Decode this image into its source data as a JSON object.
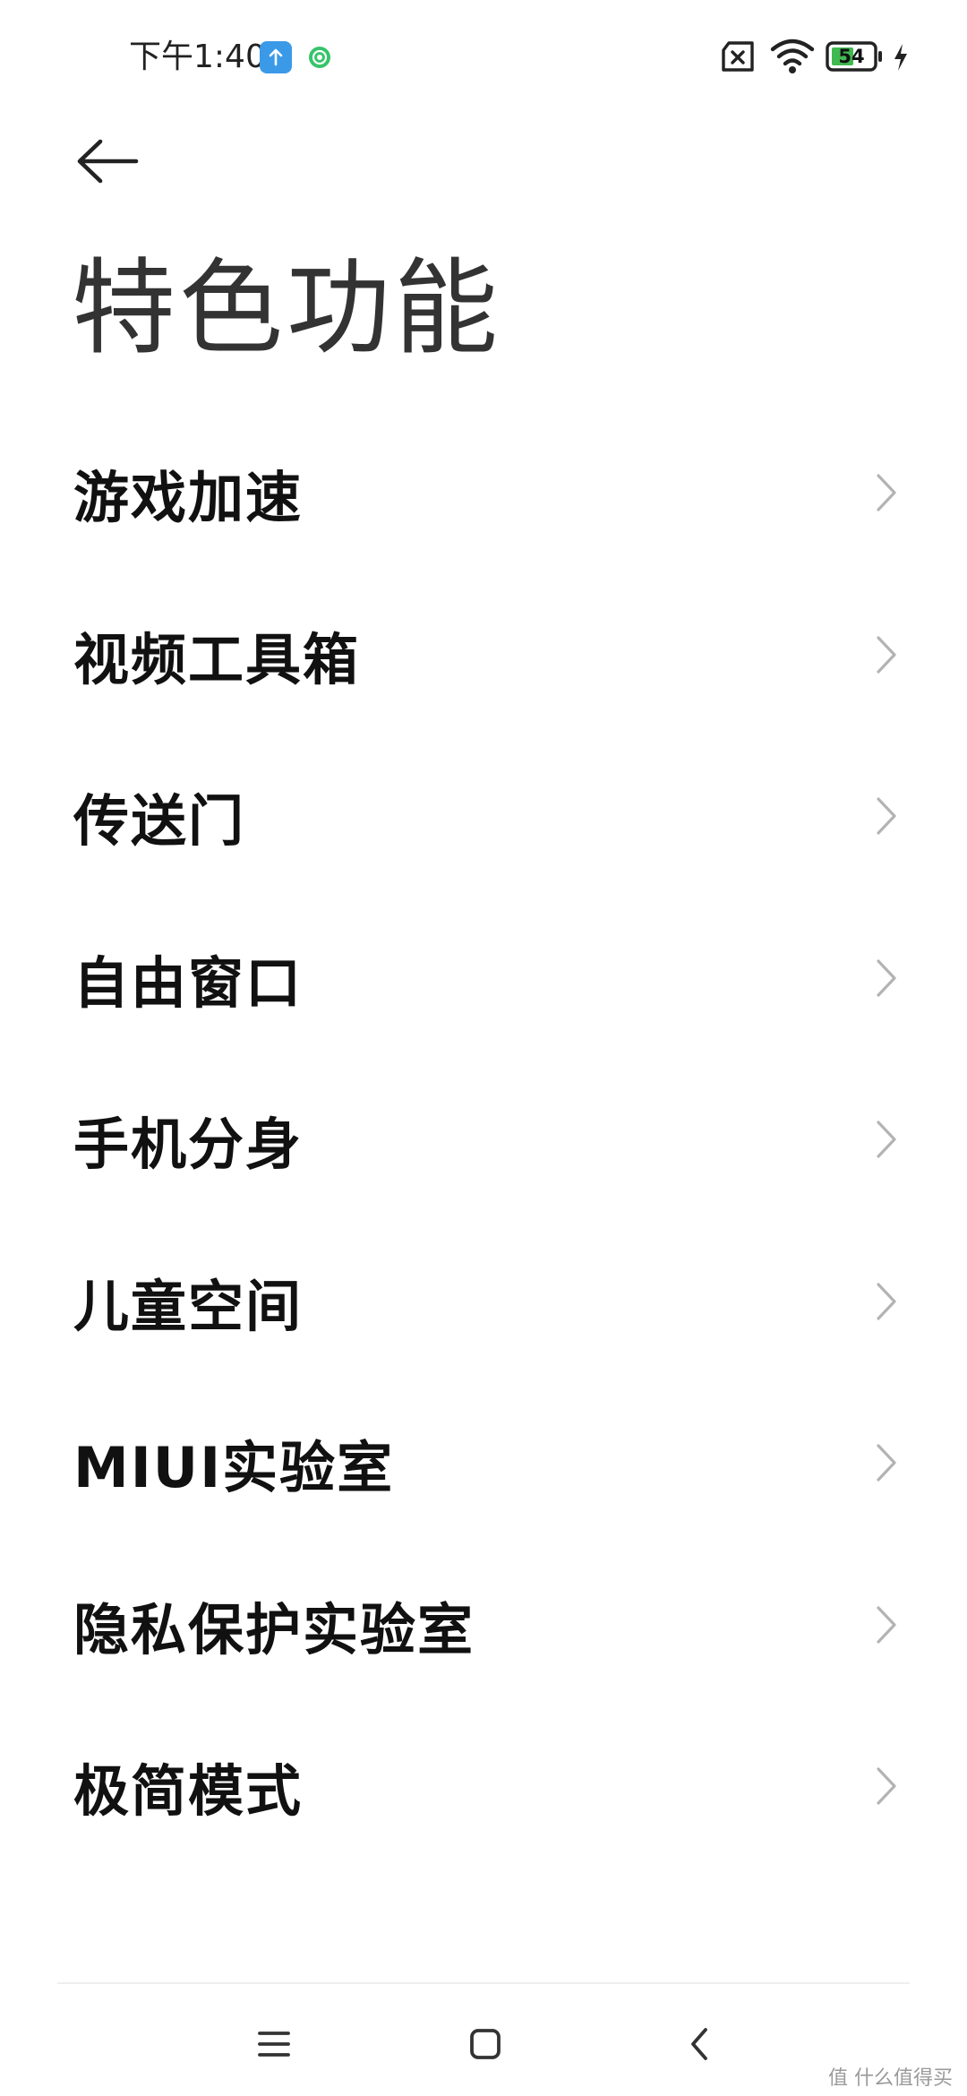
{
  "status_bar": {
    "time": "下午1:40",
    "battery_level": "54",
    "icons": [
      "upload-notification-icon",
      "green-app-notification-icon",
      "sim-error-icon",
      "wifi-icon",
      "battery-icon",
      "charging-bolt-icon"
    ],
    "battery_color": "#3fb950"
  },
  "header": {
    "title": "特色功能"
  },
  "menu": {
    "items": [
      {
        "label": "游戏加速"
      },
      {
        "label": "视频工具箱"
      },
      {
        "label": "传送门"
      },
      {
        "label": "自由窗口"
      },
      {
        "label": "手机分身"
      },
      {
        "label": "儿童空间"
      },
      {
        "label": "MIUI实验室"
      },
      {
        "label": "隐私保护实验室"
      },
      {
        "label": "极简模式"
      }
    ]
  },
  "nav": {
    "buttons": [
      "menu-icon",
      "home-icon",
      "back-icon"
    ]
  },
  "watermark": "值 什么值得买"
}
